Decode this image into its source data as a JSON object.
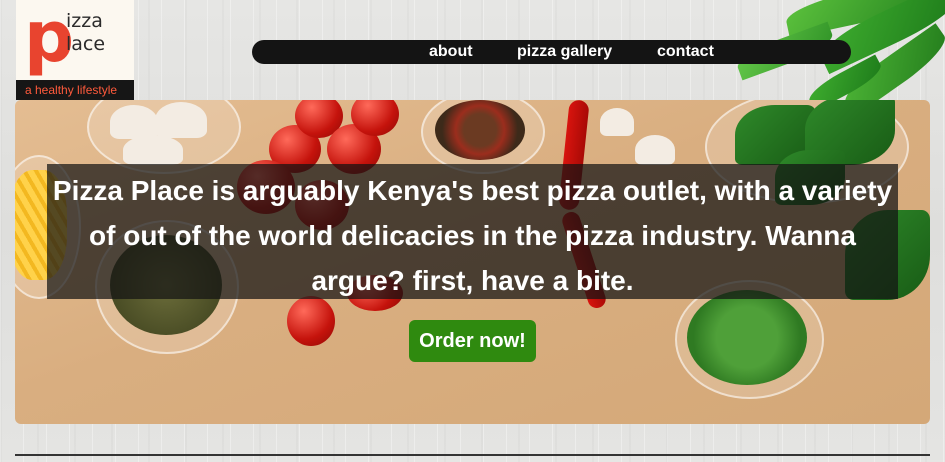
{
  "logo": {
    "letter": "p",
    "word_top": "izza",
    "word_bottom": "lace",
    "tagline": "a healthy lifestyle"
  },
  "nav": {
    "items": [
      {
        "label": "about"
      },
      {
        "label": "pizza gallery"
      },
      {
        "label": "contact"
      }
    ]
  },
  "hero": {
    "headline": "Pizza Place is arguably Kenya's best pizza outlet, with a variety of out of the world delicacies in the pizza industry. Wanna argue? first, have a bite.",
    "button_label": "Order now!"
  },
  "colors": {
    "brand_red": "#e8442f",
    "nav_bg": "#141414",
    "button_green": "#2f8a0f"
  }
}
